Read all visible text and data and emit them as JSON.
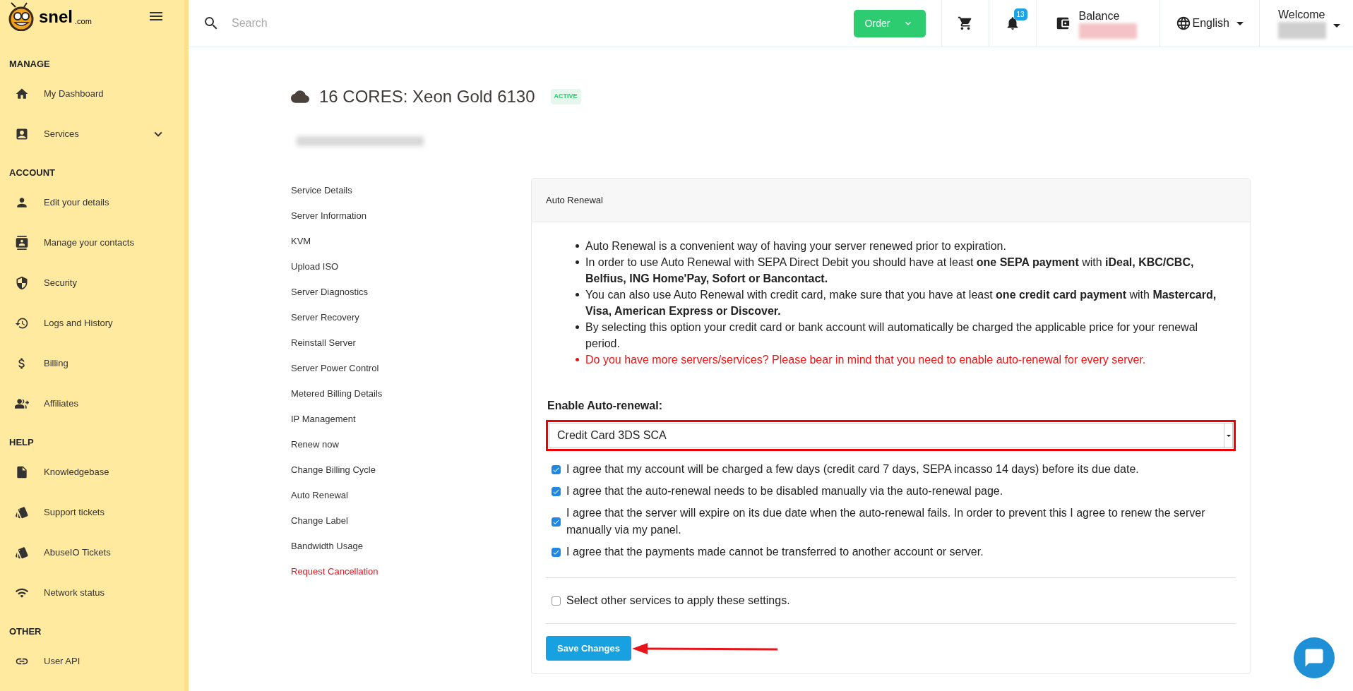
{
  "logo": {
    "name": "snel",
    "suffix": ".com"
  },
  "sidebar": {
    "sections": [
      {
        "title": "MANAGE",
        "items": [
          {
            "label": "My Dashboard"
          },
          {
            "label": "Services",
            "expanded": false
          }
        ]
      },
      {
        "title": "ACCOUNT",
        "items": [
          {
            "label": "Edit your details"
          },
          {
            "label": "Manage your contacts"
          },
          {
            "label": "Security"
          },
          {
            "label": "Logs and History"
          },
          {
            "label": "Billing"
          },
          {
            "label": "Affiliates"
          }
        ]
      },
      {
        "title": "HELP",
        "items": [
          {
            "label": "Knowledgebase"
          },
          {
            "label": "Support tickets"
          },
          {
            "label": "AbuseIO Tickets"
          },
          {
            "label": "Network status"
          }
        ]
      },
      {
        "title": "OTHER",
        "items": [
          {
            "label": "User API"
          }
        ]
      }
    ]
  },
  "header": {
    "search": {
      "placeholder": "Search"
    },
    "order_button": "Order",
    "notifications_badge": "13",
    "balance_label": "Balance",
    "language": "English",
    "welcome": "Welcome"
  },
  "service": {
    "title": "16 CORES: Xeon Gold 6130",
    "status": "ACTIVE"
  },
  "subnav": [
    {
      "label": "Service Details",
      "kind": "link"
    },
    {
      "label": "Server Information",
      "kind": "link"
    },
    {
      "label": "KVM",
      "kind": "link"
    },
    {
      "label": "Upload ISO",
      "kind": "link"
    },
    {
      "label": "Server Diagnostics",
      "kind": "link"
    },
    {
      "label": "Server Recovery",
      "kind": "link"
    },
    {
      "label": "Reinstall Server",
      "kind": "link"
    },
    {
      "label": "Server Power Control",
      "kind": "link"
    },
    {
      "label": "Metered Billing Details",
      "kind": "link"
    },
    {
      "label": "IP Management",
      "kind": "link"
    },
    {
      "label": "Renew now",
      "kind": "link"
    },
    {
      "label": "Change Billing Cycle",
      "kind": "link"
    },
    {
      "label": "Auto Renewal",
      "kind": "link"
    },
    {
      "label": "Change Label",
      "kind": "link"
    },
    {
      "label": "Bandwidth Usage",
      "kind": "link"
    },
    {
      "label": "Request Cancellation",
      "kind": "danger"
    }
  ],
  "panel": {
    "title": "Auto Renewal",
    "notes": [
      {
        "text": "Auto Renewal is a convenient way of having your server renewed prior to expiration.",
        "kind": "info"
      },
      {
        "text": "In order to use Auto Renewal with SEPA Direct Debit you should have at least **one SEPA payment** with **iDeal, KBC/CBC, Belfius, ING Home'Pay, Sofort or Bancontact.**",
        "kind": "info"
      },
      {
        "text": "You can also use Auto Renewal with credit card, make sure that you have at least **one credit card payment** with **Mastercard, Visa, American Express or Discover.**",
        "kind": "info"
      },
      {
        "text": "By selecting this option your credit card or bank account will automatically be charged the applicable price for your renewal period.",
        "kind": "info"
      },
      {
        "text": "Do you have more servers/services? Please bear in mind that you need to enable auto-renewal for every server.",
        "kind": "warning"
      }
    ],
    "select_label": "Enable Auto-renewal:",
    "select_value": "Credit Card 3DS SCA",
    "agreements": [
      {
        "label": "I agree that my account will be charged a few days (credit card 7 days, SEPA incasso 14 days) before its due date.",
        "checked": true
      },
      {
        "label": "I agree that the auto-renewal needs to be disabled manually via the auto-renewal page.",
        "checked": true
      },
      {
        "label": "I agree that the server will expire on its due date when the auto-renewal fails. In order to prevent this I agree to renew the server manually via my panel.",
        "checked": true
      },
      {
        "label": "I agree that the payments made cannot be transferred to another account or server.",
        "checked": true
      }
    ],
    "other_services": {
      "label": "Select other services to apply these settings.",
      "checked": false
    },
    "save_button": "Save Changes"
  }
}
